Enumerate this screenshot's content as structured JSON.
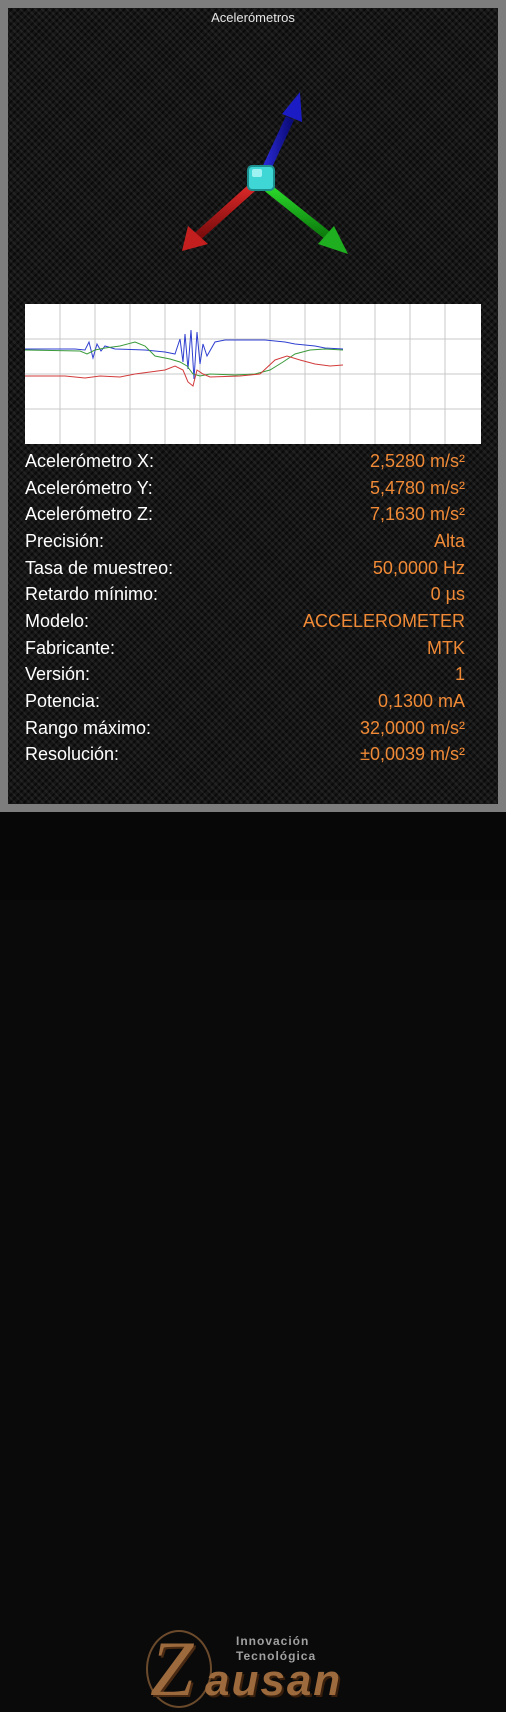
{
  "header": {
    "title": "Acelerómetros"
  },
  "orientation_widget": {
    "icon": "3d-axes-icon"
  },
  "graph": {
    "series_colors": {
      "x": "#d23b3b",
      "y": "#3a9a3a",
      "z": "#2f3fd0"
    }
  },
  "readings": [
    {
      "label": "Acelerómetro X:",
      "value": "2,5280 m/s²"
    },
    {
      "label": "Acelerómetro Y:",
      "value": "5,4780 m/s²"
    },
    {
      "label": "Acelerómetro Z:",
      "value": "7,1630 m/s²"
    },
    {
      "label": "Precisión:",
      "value": "Alta"
    },
    {
      "label": "Tasa de muestreo:",
      "value": "50,0000 Hz"
    },
    {
      "label": "Retardo mínimo:",
      "value": "0 µs"
    },
    {
      "label": "Modelo:",
      "value": "ACCELEROMETER"
    },
    {
      "label": "Fabricante:",
      "value": "MTK"
    },
    {
      "label": "Versión:",
      "value": "1"
    },
    {
      "label": "Potencia:",
      "value": "0,1300 mA"
    },
    {
      "label": "Rango máximo:",
      "value": "32,0000 m/s²"
    },
    {
      "label": "Resolución:",
      "value": "±0,0039 m/s²"
    }
  ],
  "footer": {
    "logo_icon": "zausan-logo-icon",
    "logo_line1": "Innovación",
    "logo_line2": "Tecnológica",
    "logo_name": "ausan"
  },
  "colors": {
    "label": "#ffffff",
    "value": "#f08a36",
    "accent_brown": "#9c6a3c"
  }
}
